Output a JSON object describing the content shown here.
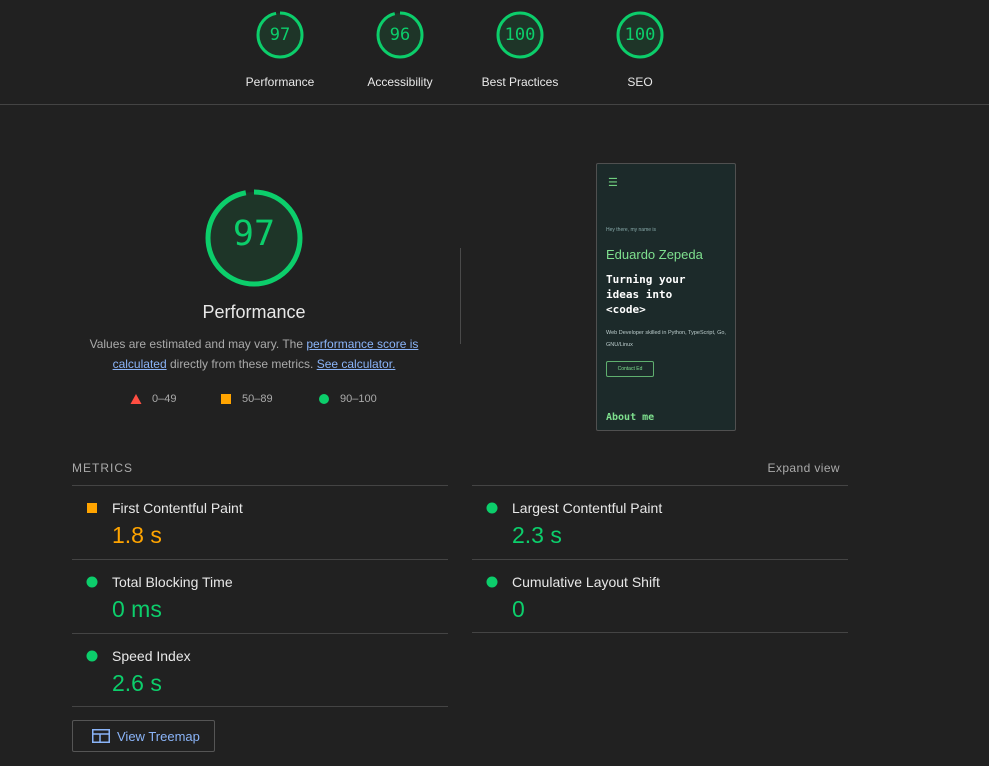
{
  "gauges": [
    {
      "score": "97",
      "label": "Performance",
      "fraction": 0.97
    },
    {
      "score": "96",
      "label": "Accessibility",
      "fraction": 0.96
    },
    {
      "score": "100",
      "label": "Best Practices",
      "fraction": 1.0
    },
    {
      "score": "100",
      "label": "SEO",
      "fraction": 1.0
    }
  ],
  "main": {
    "score": "97",
    "score_fraction": 0.97,
    "label": "Performance",
    "desc_prefix": "Values are estimated and may vary. The ",
    "desc_link1": "performance score is calculated",
    "desc_middle": " directly from these metrics. ",
    "desc_link2": "See calculator."
  },
  "legend": [
    {
      "range": "0–49",
      "shape": "triangle",
      "color": "#ff4e42"
    },
    {
      "range": "50–89",
      "shape": "square",
      "color": "#ffa400"
    },
    {
      "range": "90–100",
      "shape": "circle",
      "color": "#0cce6b"
    }
  ],
  "screenshot": {
    "menu_icon": "hamburger-icon",
    "greeting": "Hey there, my name is",
    "name": "Eduardo Zepeda",
    "tagline": "Turning your\nideas into\n<code>",
    "subtitle": "Web Developer skilled in Python, TypeScript, Go, GNU/Linux",
    "cta": "Contact Ed",
    "next_section": "About me"
  },
  "metrics": {
    "title": "METRICS",
    "expand_label": "Expand view",
    "items": [
      {
        "name": "First Contentful Paint",
        "value": "1.8 s",
        "status": "average"
      },
      {
        "name": "Largest Contentful Paint",
        "value": "2.3 s",
        "status": "pass"
      },
      {
        "name": "Total Blocking Time",
        "value": "0 ms",
        "status": "pass"
      },
      {
        "name": "Cumulative Layout Shift",
        "value": "0",
        "status": "pass"
      },
      {
        "name": "Speed Index",
        "value": "2.6 s",
        "status": "pass"
      }
    ]
  },
  "treemap": {
    "label": "View Treemap",
    "icon": "treemap-icon"
  },
  "colors": {
    "pass": "#0cce6b",
    "average": "#ffa400",
    "fail": "#ff4e42"
  }
}
